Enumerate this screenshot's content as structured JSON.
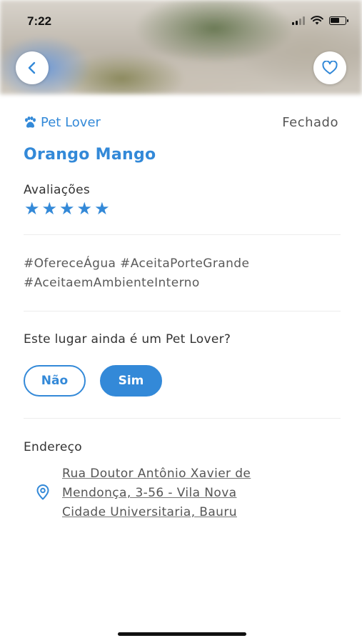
{
  "status_bar": {
    "time": "7:22"
  },
  "place": {
    "category": "Pet Lover",
    "open_status": "Fechado",
    "name": "Orango Mango",
    "rating_label": "Avaliações",
    "rating": 5,
    "rating_max": 5,
    "tags_line1": "#OfereceÁgua #AceitaPorteGrande",
    "tags_line2": "#AceitaemAmbienteInterno"
  },
  "feedback": {
    "question": "Este lugar ainda é um Pet Lover?",
    "no_label": "Não",
    "yes_label": "Sim"
  },
  "address": {
    "label": "Endereço",
    "line1": "Rua Doutor Antônio Xavier de",
    "line2": "Mendonça, 3-56 - Vila Nova",
    "line3": "Cidade Universitaria, Bauru"
  },
  "icons": {
    "back": "chevron-left-icon",
    "favorite": "heart-icon",
    "category": "paw-icon",
    "star": "star-icon",
    "location": "map-pin-icon"
  },
  "colors": {
    "accent": "#3389d8",
    "text": "#333333",
    "muted": "#555555"
  }
}
